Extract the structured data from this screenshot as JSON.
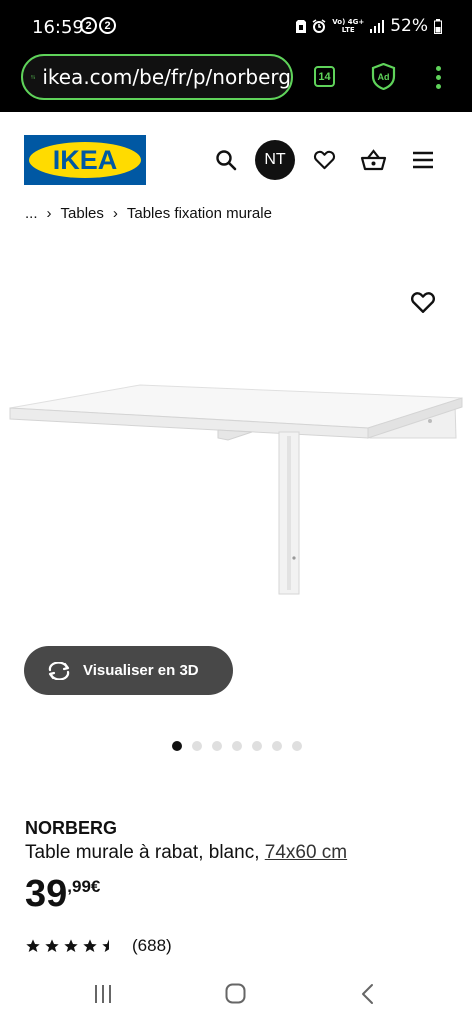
{
  "status_bar": {
    "time": "16:59",
    "notif_counts": [
      "2",
      "2"
    ],
    "network_label_top": "Vo) 4G+",
    "network_label_bottom": "LTE",
    "battery": "52%"
  },
  "browser": {
    "url": "ikea.com/be/fr/p/norberg",
    "tab_count": "14",
    "adblock_label": "Ad",
    "accent_color": "#5fd35a"
  },
  "header": {
    "logo_text": "IKEA",
    "avatar_initials": "NT",
    "brand_blue": "#0058a3",
    "brand_yellow": "#ffdb00"
  },
  "breadcrumb": {
    "ellipsis": "...",
    "items": [
      "Tables",
      "Tables fixation murale"
    ],
    "separator": "›"
  },
  "product": {
    "image_dots": 7,
    "active_dot": 0,
    "view_3d_label": "Visualiser en 3D",
    "name": "NORBERG",
    "description": "Table murale à rabat, blanc, ",
    "size": "74x60 cm",
    "price_integer": "39",
    "price_decimal": ",99€",
    "rating_value": 4.5,
    "rating_count": "(688)"
  }
}
